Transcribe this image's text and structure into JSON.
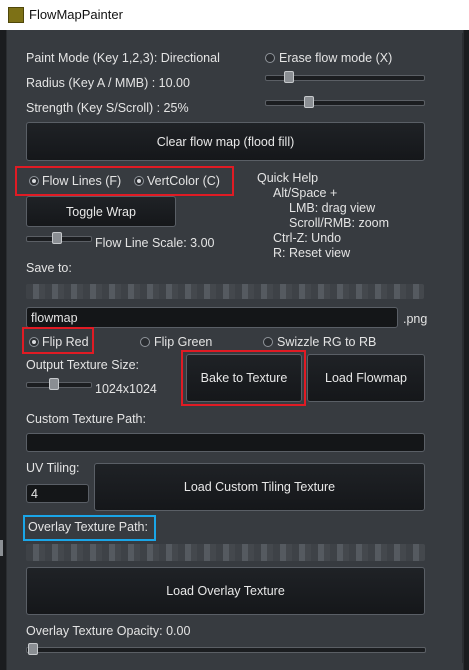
{
  "window": {
    "title": "FlowMapPainter"
  },
  "paint": {
    "mode_label": "Paint Mode (Key 1,2,3): Directional",
    "erase_label": "Erase flow mode (X)",
    "radius_label": "Radius (Key A / MMB) : 10.00",
    "strength_label": "Strength (Key S/Scroll) : 25%",
    "radius_value": 0.1,
    "strength_value": 0.25,
    "clear_button": "Clear flow map (flood fill)"
  },
  "display": {
    "flow_lines_label": "Flow Lines (F)",
    "vertcolor_label": "VertColor (C)",
    "toggle_wrap_button": "Toggle Wrap",
    "flow_line_scale_label": "Flow Line Scale: 3.00",
    "flow_line_scale_value": 0.3
  },
  "help": {
    "title": "Quick Help",
    "lines": [
      "Alt/Space +",
      "LMB: drag view",
      "Scroll/RMB: zoom",
      "Ctrl-Z: Undo",
      "R: Reset view"
    ]
  },
  "save": {
    "label": "Save to:",
    "filename": "flowmap",
    "extension": ".png",
    "flip_red": "Flip Red",
    "flip_green": "Flip Green",
    "swizzle": "Swizzle RG to RB",
    "output_size_label": "Output Texture Size:",
    "output_size_value": "1024x1024",
    "output_size_slider": 0.35,
    "bake_button": "Bake to Texture",
    "load_flowmap_button": "Load Flowmap"
  },
  "custom_texture": {
    "label": "Custom Texture Path:",
    "path": "",
    "uv_tiling_label": "UV Tiling:",
    "uv_tiling_value": "4",
    "load_button": "Load Custom Tiling Texture"
  },
  "overlay": {
    "label": "Overlay Texture Path:",
    "load_button": "Load Overlay Texture",
    "opacity_label": "Overlay Texture Opacity: 0.00",
    "opacity_value": 0.0
  },
  "colors": {
    "highlight_red": "#e01b24",
    "highlight_blue": "#1aa6e8",
    "panel": "#373b40",
    "title_icon": "#7d7116"
  }
}
